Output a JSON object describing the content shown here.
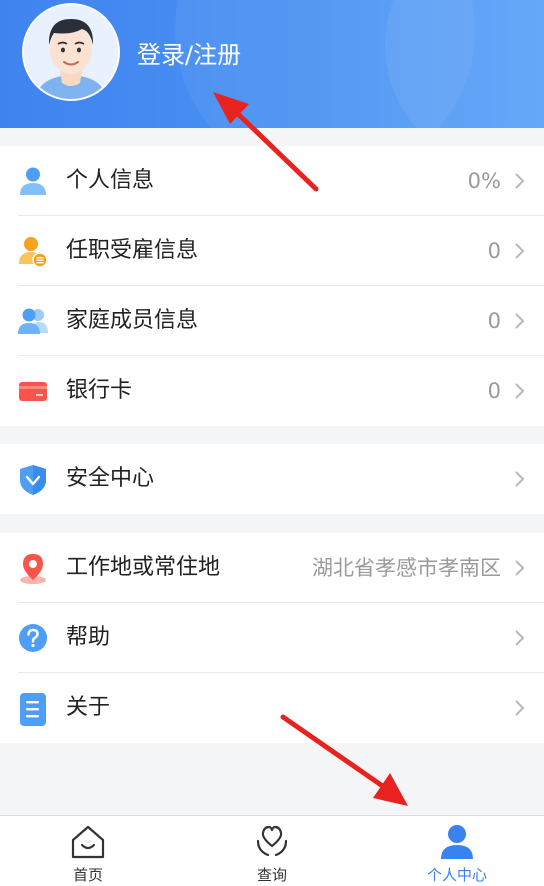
{
  "header": {
    "login_label": "登录/注册"
  },
  "groups": [
    {
      "items": [
        {
          "label": "个人信息",
          "value": "0%",
          "icon": "person-icon"
        },
        {
          "label": "任职受雇信息",
          "value": "0",
          "icon": "employee-icon"
        },
        {
          "label": "家庭成员信息",
          "value": "0",
          "icon": "family-icon"
        },
        {
          "label": "银行卡",
          "value": "0",
          "icon": "bank-card-icon"
        }
      ]
    },
    {
      "items": [
        {
          "label": "安全中心",
          "value": "",
          "icon": "shield-icon"
        }
      ]
    },
    {
      "items": [
        {
          "label": "工作地或常住地",
          "value": "湖北省孝感市孝南区",
          "icon": "location-pin-icon"
        },
        {
          "label": "帮助",
          "value": "",
          "icon": "help-icon"
        },
        {
          "label": "关于",
          "value": "",
          "icon": "document-icon"
        }
      ]
    }
  ],
  "bottom_nav": {
    "items": [
      {
        "label": "首页",
        "icon": "home-icon",
        "active": false
      },
      {
        "label": "查询",
        "icon": "heart-hands-icon",
        "active": false
      },
      {
        "label": "个人中心",
        "icon": "person-icon",
        "active": true
      }
    ]
  },
  "colors": {
    "header_blue": "#4188f0",
    "accent_blue": "#3a82f0",
    "annotation_arrow": "#e8231f"
  }
}
